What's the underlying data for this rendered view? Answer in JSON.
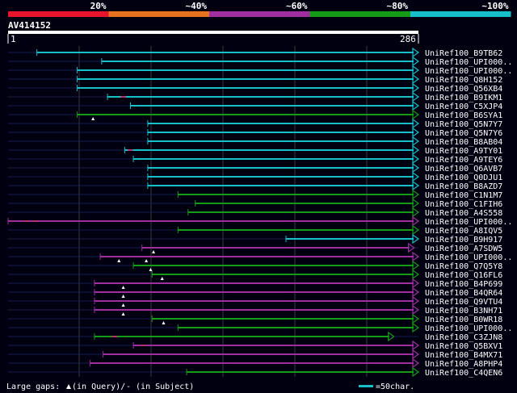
{
  "scale": {
    "labels": [
      "20%",
      "~40%",
      "~60%",
      "~80%",
      "~100%"
    ],
    "colors": [
      "#e8132d",
      "#e8731e",
      "#a12e9e",
      "#169b16",
      "#17c0c8"
    ]
  },
  "query": {
    "id": "AV414152",
    "start": "1",
    "end": "286",
    "length": 286
  },
  "colors": {
    "background": "#000010",
    "grid": "#3a3a3a",
    "row_line": "#151e4e",
    "query_bar": "#ffffff",
    "gap_marker": "#ffffff"
  },
  "hits": [
    {
      "name": "UniRef100_B9TB62",
      "start": 21,
      "end": 286,
      "color": "#17c0c8",
      "gaps": []
    },
    {
      "name": "UniRef100_UPI000..",
      "start": 66,
      "end": 286,
      "color": "#17c0c8",
      "gaps": []
    },
    {
      "name": "UniRef100_UPI000..",
      "start": 49,
      "end": 286,
      "color": "#17c0c8",
      "gaps": []
    },
    {
      "name": "UniRef100_Q8H152",
      "start": 49,
      "end": 286,
      "color": "#17c0c8",
      "gaps": []
    },
    {
      "name": "UniRef100_Q56XB4",
      "start": 49,
      "end": 286,
      "color": "#17c0c8",
      "gaps": []
    },
    {
      "name": "UniRef100_B9IKM1",
      "start": 70,
      "end": 286,
      "color": "#17c0c8",
      "gaps": [
        81
      ]
    },
    {
      "name": "UniRef100_C5XJP4",
      "start": 86,
      "end": 286,
      "color": "#17c0c8",
      "gaps": []
    },
    {
      "name": "UniRef100_B6SYA1",
      "start": 49,
      "end": 286,
      "color": "#169b16",
      "gaps": [],
      "markers": [
        60
      ]
    },
    {
      "name": "UniRef100_Q5N7Y7",
      "start": 98,
      "end": 286,
      "color": "#17c0c8",
      "gaps": []
    },
    {
      "name": "UniRef100_Q5N7Y6",
      "start": 98,
      "end": 286,
      "color": "#17c0c8",
      "gaps": []
    },
    {
      "name": "UniRef100_B8AB04",
      "start": 98,
      "end": 286,
      "color": "#17c0c8",
      "gaps": []
    },
    {
      "name": "UniRef100_A9TY01",
      "start": 82,
      "end": 286,
      "color": "#17c0c8",
      "gaps": [
        86
      ]
    },
    {
      "name": "UniRef100_A9TEY6",
      "start": 88,
      "end": 286,
      "color": "#17c0c8",
      "gaps": []
    },
    {
      "name": "UniRef100_Q6AVB7",
      "start": 98,
      "end": 286,
      "color": "#17c0c8",
      "gaps": []
    },
    {
      "name": "UniRef100_Q0DJU1",
      "start": 98,
      "end": 286,
      "color": "#17c0c8",
      "gaps": []
    },
    {
      "name": "UniRef100_B8AZD7",
      "start": 98,
      "end": 286,
      "color": "#17c0c8",
      "gaps": []
    },
    {
      "name": "UniRef100_C1N1M7",
      "start": 119,
      "end": 286,
      "color": "#169b16",
      "gaps": []
    },
    {
      "name": "UniRef100_C1FIH6",
      "start": 131,
      "end": 286,
      "color": "#169b16",
      "gaps": []
    },
    {
      "name": "UniRef100_A4S558",
      "start": 126,
      "end": 286,
      "color": "#169b16",
      "gaps": []
    },
    {
      "name": "UniRef100_UPI000..",
      "start": 1,
      "end": 286,
      "color": "#a12e9e",
      "gaps": [
        14,
        20
      ]
    },
    {
      "name": "UniRef100_A8IQV5",
      "start": 119,
      "end": 286,
      "color": "#169b16",
      "gaps": []
    },
    {
      "name": "UniRef100_B9H917",
      "start": 194,
      "end": 286,
      "color": "#17c0c8",
      "gaps": []
    },
    {
      "name": "UniRef100_A7SDW5",
      "start": 94,
      "end": 283,
      "color": "#a12e9e",
      "gaps": [],
      "markers": [
        102
      ]
    },
    {
      "name": "UniRef100_UPI000..",
      "start": 65,
      "end": 286,
      "color": "#a12e9e",
      "gaps": [],
      "markers": [
        78,
        97
      ]
    },
    {
      "name": "UniRef100_Q7Q5Y8",
      "start": 88,
      "end": 286,
      "color": "#169b16",
      "gaps": [],
      "markers": [
        100
      ]
    },
    {
      "name": "UniRef100_Q16FL6",
      "start": 101,
      "end": 286,
      "color": "#169b16",
      "gaps": [],
      "markers": [
        108
      ]
    },
    {
      "name": "UniRef100_B4P699",
      "start": 61,
      "end": 286,
      "color": "#a12e9e",
      "gaps": [],
      "markers": [
        81
      ]
    },
    {
      "name": "UniRef100_B4QR64",
      "start": 61,
      "end": 286,
      "color": "#a12e9e",
      "gaps": [],
      "markers": [
        81
      ]
    },
    {
      "name": "UniRef100_Q9VTU4",
      "start": 61,
      "end": 286,
      "color": "#a12e9e",
      "gaps": [],
      "markers": [
        81
      ]
    },
    {
      "name": "UniRef100_B3NH71",
      "start": 61,
      "end": 286,
      "color": "#a12e9e",
      "gaps": [],
      "markers": [
        81
      ]
    },
    {
      "name": "UniRef100_B0WR18",
      "start": 101,
      "end": 286,
      "color": "#169b16",
      "gaps": [],
      "markers": [
        109
      ]
    },
    {
      "name": "UniRef100_UPI000..",
      "start": 119,
      "end": 286,
      "color": "#169b16",
      "gaps": []
    },
    {
      "name": "UniRef100_C3ZJN8",
      "start": 61,
      "end": 269,
      "color": "#169b16",
      "gaps": [
        75
      ]
    },
    {
      "name": "UniRef100_Q5BXV1",
      "start": 88,
      "end": 286,
      "color": "#a12e9e",
      "gaps": [
        95
      ]
    },
    {
      "name": "UniRef100_B4MX71",
      "start": 67,
      "end": 286,
      "color": "#a12e9e",
      "gaps": []
    },
    {
      "name": "UniRef100_A8PHP4",
      "start": 58,
      "end": 286,
      "color": "#a12e9e",
      "gaps": []
    },
    {
      "name": "UniRef100_C4QEN6",
      "start": 125,
      "end": 286,
      "color": "#169b16",
      "gaps": []
    }
  ],
  "legend": {
    "gaps_text": "Large gaps:",
    "query_text": "(in Query)/",
    "subject_text": "- (in Subject)",
    "scale_text": "=50char."
  }
}
